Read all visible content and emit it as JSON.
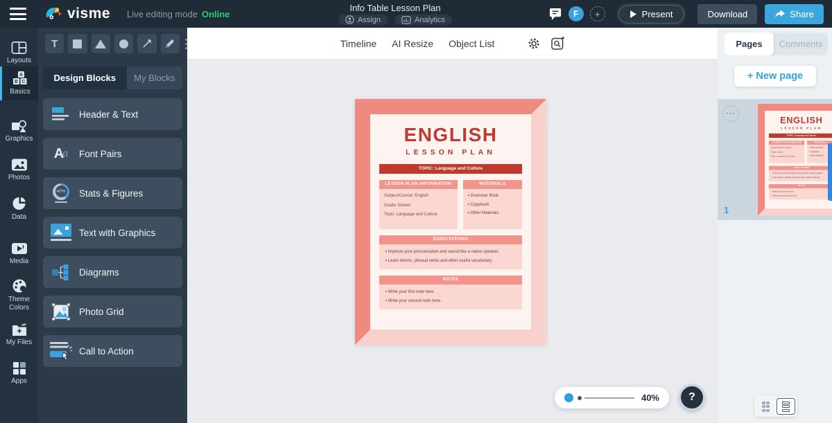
{
  "colors": {
    "accent_blue": "#38a6d8",
    "online_green": "#2ecc71",
    "topbar_bg": "#1f2b37",
    "panel_bg": "#2c3a48",
    "doc_red": "#c0392d",
    "doc_salmon": "#f2948b",
    "doc_pink": "#fbd7d2",
    "scrollbar_blue": "#2e86e8"
  },
  "topbar": {
    "logo_text": "visme",
    "mode_label": "Live editing mode",
    "status_label": "Online",
    "doc_title": "Info Table Lesson Plan",
    "assign_label": "Assign",
    "analytics_label": "Analytics",
    "avatar_initial": "F",
    "add_collaborator_label": "+",
    "present_label": "Present",
    "download_label": "Download",
    "share_label": "Share"
  },
  "toolbar": {
    "text_tool_label": "T",
    "timeline_label": "Timeline",
    "ai_resize_label": "AI Resize",
    "object_list_label": "Object List"
  },
  "panel_tabs": {
    "pages_label": "Pages",
    "comments_label": "Comments"
  },
  "sidebar": {
    "active_item": "Basics",
    "items": [
      {
        "label": "Layouts"
      },
      {
        "label": "Basics"
      },
      {
        "label": "Graphics"
      },
      {
        "label": "Photos"
      },
      {
        "label": "Data"
      },
      {
        "label": "Media"
      },
      {
        "label": "Theme Colors"
      },
      {
        "label": "My Files"
      },
      {
        "label": "Apps"
      }
    ]
  },
  "blocks_panel": {
    "design_blocks_tab": "Design Blocks",
    "my_blocks_tab": "My Blocks",
    "items": [
      {
        "label": "Header & Text"
      },
      {
        "label": "Font Pairs"
      },
      {
        "label": "Stats & Figures",
        "icon_value": "40%"
      },
      {
        "label": "Text with Graphics"
      },
      {
        "label": "Diagrams"
      },
      {
        "label": "Photo Grid"
      },
      {
        "label": "Call to Action"
      }
    ]
  },
  "document": {
    "title": "ENGLISH",
    "subtitle": "LESSON PLAN",
    "topic_banner": "TOPIC: Language and Culture",
    "info_header": "LESSON PLAN INFORMATION",
    "info_rows": [
      "Subject/Course: English",
      "Grade: Eleven",
      "Topic: Language and Culture"
    ],
    "materials_header": "MATERIALS",
    "materials_bullets": [
      "Grammar Book",
      "Copybook",
      "Other Materials"
    ],
    "expectations_header": "EXPECTATIONS",
    "expectations_bullets": [
      "Improve your pronunciation and sound like a native speaker.",
      "Learn idioms, phrasal verbs and other useful vocabulary."
    ],
    "notes_header": "NOTES",
    "notes_bullets": [
      "Write your first note here.",
      "Write your second note here."
    ]
  },
  "pages_panel": {
    "new_page_label": "+ New page",
    "page_number": "1"
  },
  "statusbar": {
    "zoom_value": "40%",
    "help_label": "?"
  }
}
